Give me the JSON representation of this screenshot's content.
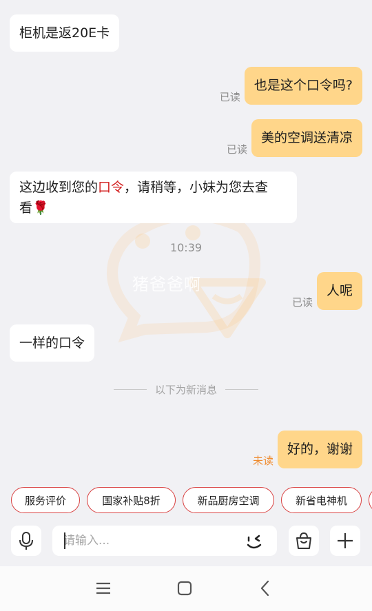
{
  "messages": {
    "m1": "柜机是返20E卡",
    "m2": "也是这个口令吗?",
    "m2_status": "已读",
    "m3": "美的空调送清凉",
    "m3_status": "已读",
    "m4_pre": "这边收到您的",
    "m4_highlight": "口令",
    "m4_post_line1": "，请稍等，小妹为您去查",
    "m4_line2": "看",
    "m4_emoji": "🌹",
    "time": "10:39",
    "m5": "人呢",
    "m5_status": "已读",
    "m6": "一样的口令",
    "new_divider": "以下为新消息",
    "m7": "好的，谢谢",
    "m7_status": "未读"
  },
  "watermark": "猪爸爸啊",
  "quick_replies": [
    "服务评价",
    "国家补贴8折",
    "新品厨房空调",
    "新省电神机"
  ],
  "input": {
    "placeholder": "请输入..."
  },
  "icons": {
    "voice": "microphone-icon",
    "emoji": "emoji-wink-icon",
    "shop": "shopping-bag-icon",
    "plus": "plus-icon",
    "nav_menu": "menu-icon",
    "nav_home": "home-square-icon",
    "nav_back": "back-chevron-icon"
  },
  "colors": {
    "outgoing_bubble": "#ffd68a",
    "incoming_bubble": "#ffffff",
    "highlight": "#d21c1c",
    "unread": "#ef8a2c",
    "chip_border": "#d94040"
  }
}
